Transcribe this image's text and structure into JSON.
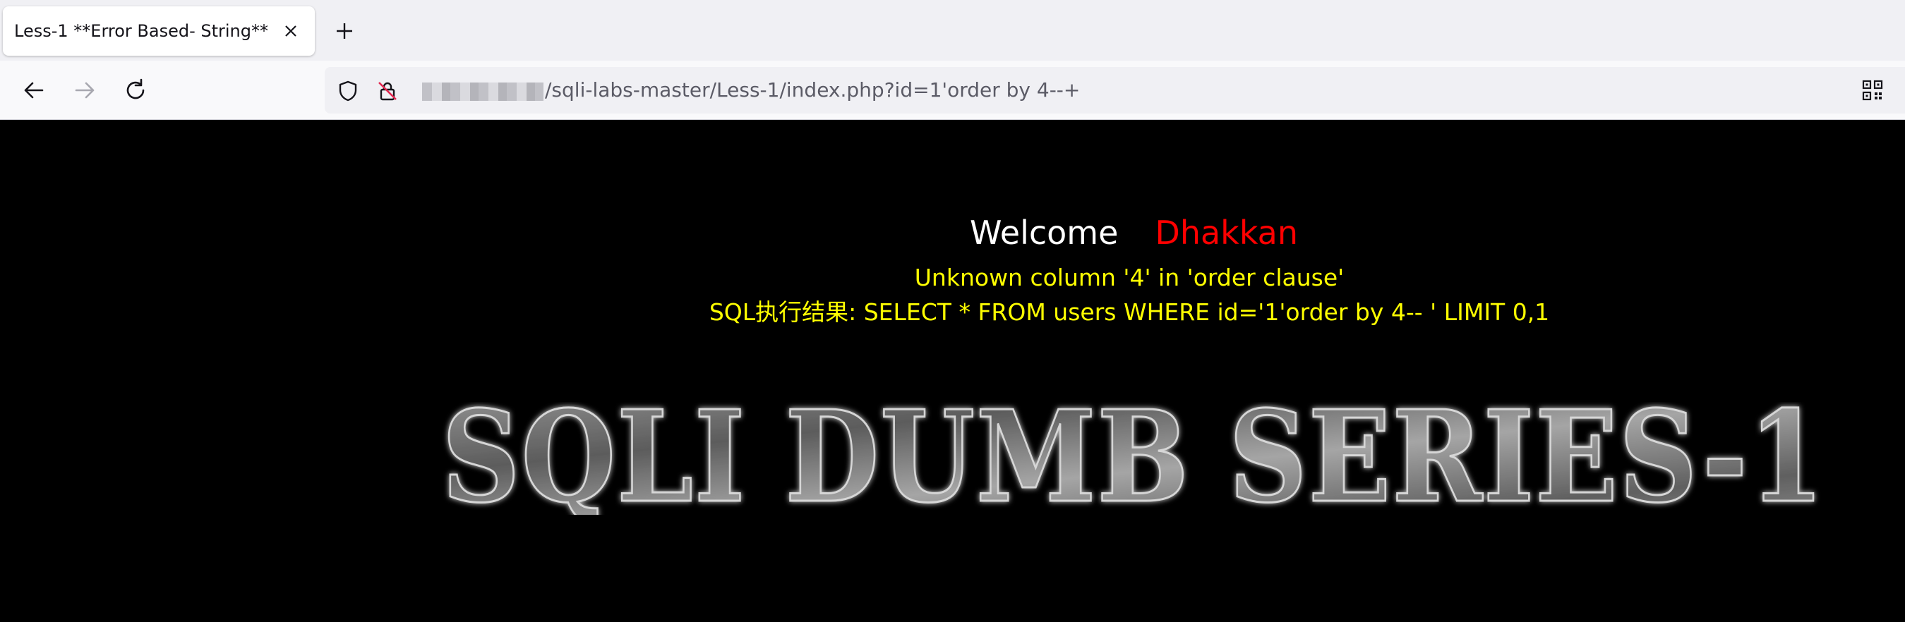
{
  "browser": {
    "tab": {
      "title": "Less-1 **Error Based- String**"
    },
    "url": {
      "visible_path": "/sqli-labs-master/Less-1/index.php?id=1'order by 4--+"
    }
  },
  "page": {
    "welcome_label": "Welcome",
    "welcome_name": "Dhakkan",
    "error_message": "Unknown column '4' in 'order clause'",
    "sql_result": "SQL执行结果: SELECT * FROM users WHERE id='1'order by 4-- ' LIMIT 0,1",
    "banner_text": "SQLI DUMB SERIES-1"
  },
  "colors": {
    "welcome_label": "#ffffff",
    "welcome_name": "#ff0000",
    "error_text": "#ffff00",
    "background": "#000000"
  },
  "icons": {
    "tab_close": "close-icon",
    "new_tab": "plus-icon",
    "back": "arrow-left-icon",
    "forward": "arrow-right-icon",
    "reload": "reload-icon",
    "tracking_protection": "shield-icon",
    "insecure": "lock-slash-icon",
    "qr": "qr-code-icon"
  }
}
